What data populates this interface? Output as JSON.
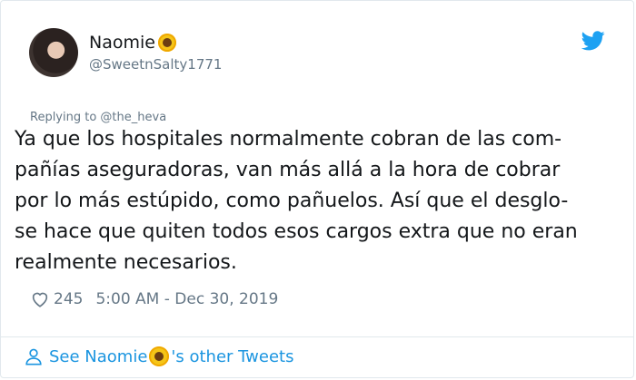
{
  "user": {
    "display_name": "Naomie",
    "handle": "@SweetnSalty1771",
    "name_emoji": "sunflower-icon"
  },
  "tweet": {
    "reply_to": "Replying to @the_heva",
    "lines": [
      "Ya que los hospitales normalmente cobran de las com-",
      "pañías aseguradoras, van más allá a la hora de cobrar",
      "por lo más estúpido, como pañuelos. Así que el desglo-",
      "se hace que quiten todos esos cargos extra que no eran",
      "realmente necesarios."
    ],
    "likes": "245",
    "timestamp": "5:00 AM - Dec 30, 2019"
  },
  "footer": {
    "prefix": "See Naomie",
    "suffix": "'s other Tweets"
  },
  "colors": {
    "accent": "#1b95e0",
    "muted": "#657786",
    "text": "#14171a"
  }
}
